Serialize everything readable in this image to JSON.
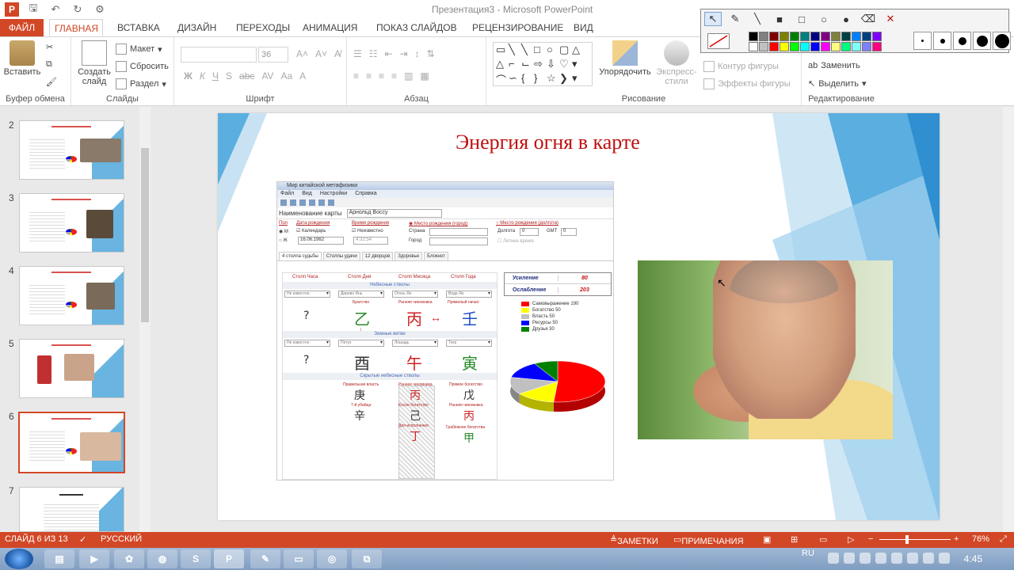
{
  "window": {
    "title": "Презентация3 - Microsoft PowerPoint",
    "app_letter": "P"
  },
  "ribbon_tabs": [
    {
      "label": "ФАЙЛ"
    },
    {
      "label": "ГЛАВНАЯ"
    },
    {
      "label": "ВСТАВКА"
    },
    {
      "label": "ДИЗАЙН"
    },
    {
      "label": "ПЕРЕХОДЫ"
    },
    {
      "label": "АНИМАЦИЯ"
    },
    {
      "label": "ПОКАЗ СЛАЙДОВ"
    },
    {
      "label": "РЕЦЕНЗИРОВАНИЕ"
    },
    {
      "label": "ВИД"
    }
  ],
  "ribbon": {
    "clipboard": {
      "paste_label": "Вставить",
      "group_label": "Буфер обмена"
    },
    "slides": {
      "new_slide_label": "Создать слайд",
      "layout_label": "Макет",
      "reset_label": "Сбросить",
      "section_label": "Раздел",
      "group_label": "Слайды"
    },
    "font": {
      "size": "36",
      "group_label": "Шрифт",
      "format_buttons": [
        "Ж",
        "К",
        "Ч",
        "S",
        "abc",
        "AV",
        "Aa",
        "A"
      ]
    },
    "paragraph": {
      "group_label": "Абзац"
    },
    "drawing": {
      "arrange_label": "Упорядочить",
      "styles_label": "Экспресс-стили",
      "outline_label": "Контур фигуры",
      "effects_label": "Эффекты фигуры",
      "group_label": "Рисование"
    },
    "editing": {
      "replace_label": "Заменить",
      "select_label": "Выделить",
      "group_label": "Редактирование"
    }
  },
  "pen_toolbar": {
    "tools": [
      "pointer-icon",
      "pen-icon",
      "line-icon",
      "filled-rect-icon",
      "rect-icon",
      "ellipse-icon",
      "filled-ellipse-icon",
      "eraser-icon",
      "close-icon"
    ],
    "colors": [
      "#000000",
      "#808080",
      "#800000",
      "#808000",
      "#008000",
      "#008080",
      "#000080",
      "#800080",
      "#808040",
      "#004040",
      "#0080ff",
      "#004080",
      "#8000ff",
      "#ffffff",
      "#c0c0c0",
      "#ff0000",
      "#ffff00",
      "#00ff00",
      "#00ffff",
      "#0000ff",
      "#ff00ff",
      "#ffff80",
      "#00ff80",
      "#80ffff",
      "#8080ff",
      "#ff0080"
    ]
  },
  "thumbnails": [
    {
      "number": "2"
    },
    {
      "number": "3"
    },
    {
      "number": "4"
    },
    {
      "number": "5"
    },
    {
      "number": "6"
    },
    {
      "number": "7"
    }
  ],
  "slide": {
    "title": "Энергия огня в карте",
    "app": {
      "title": "Мир китайской метафизики",
      "menu": [
        "Файл",
        "Вид",
        "Настройки",
        "Справка"
      ],
      "name_label": "Наименование карты",
      "name_value": "Арнольд Восcу",
      "gender_label": "Пол",
      "gender_m": "М",
      "gender_f": "Ж",
      "birthdate_label": "Дата рождения",
      "calendar_label": "Календарь",
      "birthdate_value": "16.06.1962",
      "birthtime_label": "Время рождения",
      "unknown_label": "Неизвестно",
      "birthtime_value": "4:32:54",
      "birthplace_city_label": "Место рождения (город)",
      "country_label": "Страна",
      "city_label": "Город",
      "birthplace_long_label": "Место рождения (долгота)",
      "longitude_label": "Долгота",
      "longitude_value": "0",
      "gmt_label": "GMT",
      "gmt_value": "0",
      "summer_label": "Летнее время",
      "subtabs": [
        "4 столпа судьбы",
        "Столпы удачи",
        "12 дворцов",
        "Здоровье",
        "Блокнот"
      ],
      "pillar_heads": [
        "Столп Часа",
        "Столп Дня",
        "Столп Месяца",
        "Столп Года"
      ],
      "heavenly_label": "Небесные стволы",
      "earthly_label": "Земные ветви",
      "hidden_label": "Скрытые небесные стволы",
      "heavenly_dd": [
        "Не известно",
        "Дерево Инь",
        "Огонь Ян",
        "Вода Ян"
      ],
      "earthly_dd": [
        "Не известно",
        "Петух",
        "Лошадь",
        "Тигр"
      ],
      "heavenly_sub": [
        "Братство",
        "Ранняя чиновника",
        "Прямолый начал"
      ],
      "heavenly_glyphs": [
        "?",
        "乙",
        "丙",
        "壬"
      ],
      "earthly_glyphs": [
        "?",
        "酉",
        "午",
        "寅"
      ],
      "hidden": [
        {
          "label": "Правильная власть",
          "glyph": "庚"
        },
        {
          "label": "7-й убийца",
          "glyph": "辛"
        },
        {
          "label": "Раннее чиновника",
          "glyph": "丙"
        },
        {
          "label": "Косое богатство",
          "glyph": "己"
        },
        {
          "label": "Для исполнения",
          "glyph": "丁"
        },
        {
          "label": "Прямое богатство",
          "glyph": "戊"
        },
        {
          "label": "Ранняя чиновника",
          "glyph": "丙"
        },
        {
          "label": "Грабёжное богатства",
          "glyph": "甲"
        }
      ],
      "score": [
        {
          "label": "Усиление",
          "value": "80"
        },
        {
          "label": "Ослабление",
          "value": "203"
        }
      ],
      "legend": [
        {
          "label": "Самовыражение",
          "value": "190",
          "color": "#ff0000"
        },
        {
          "label": "Богатство",
          "value": "50",
          "color": "#ffff00"
        },
        {
          "label": "Власть",
          "value": "50",
          "color": "#c0c0c0"
        },
        {
          "label": "Ресурсы",
          "value": "50",
          "color": "#0000ff"
        },
        {
          "label": "Друзья",
          "value": "30",
          "color": "#008000"
        }
      ]
    }
  },
  "chart_data": {
    "type": "pie",
    "categories": [
      "Самовыражение",
      "Богатство",
      "Власть",
      "Ресурсы",
      "Друзья"
    ],
    "values": [
      190,
      50,
      50,
      50,
      30
    ],
    "colors": [
      "#ff0000",
      "#ffff00",
      "#c0c0c0",
      "#0000ff",
      "#008000"
    ]
  },
  "statusbar": {
    "slide_info": "СЛАЙД 6 ИЗ 13",
    "language": "РУССКИЙ",
    "notes_label": "ЗАМЕТКИ",
    "comments_label": "ПРИМЕЧАНИЯ",
    "zoom": "76%"
  },
  "taskbar": {
    "lang": "RU",
    "time": "4:45",
    "apps": [
      "explorer",
      "media",
      "settings",
      "firefox",
      "skype",
      "powerpoint",
      "paint",
      "display",
      "chrome",
      "other"
    ]
  }
}
